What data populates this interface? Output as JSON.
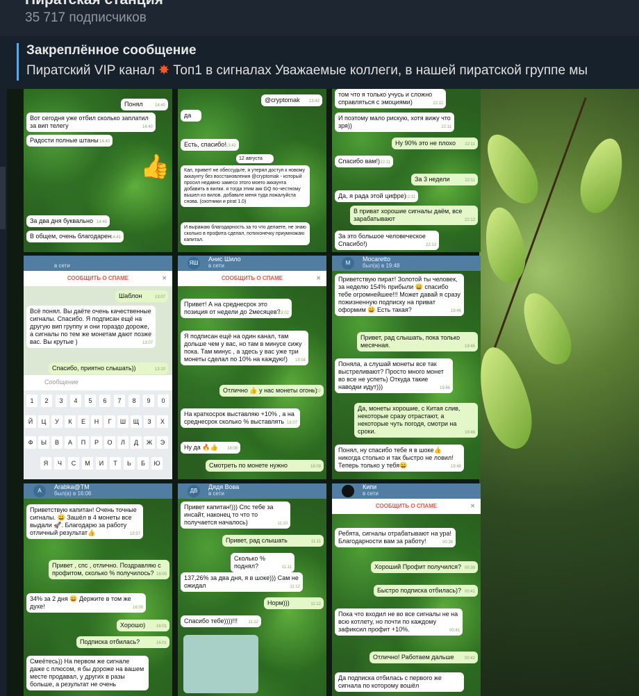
{
  "channel": {
    "title": "Пиратская станция",
    "subscribers": "35 717 подписчиков"
  },
  "pinned": {
    "label": "Закреплённое сообщение",
    "text_a": "Пиратский VIP канал",
    "text_b": "Топ1 в сигналах  Уважаемые коллеги, в нашей пиратской группе мы",
    "fire_icon": "fire-icon"
  },
  "tiles": {
    "t1": [
      {
        "text": "Понял",
        "time": "14:40"
      },
      {
        "text": "Вот сегодня уже отбил сколько заплатил за вип телегу",
        "time": "14:40"
      },
      {
        "text": "Радости полные штаны",
        "time": "14:40"
      },
      {
        "text": "За два дня буквально",
        "time": "14:40"
      },
      {
        "text": "В общем, очень благодарен",
        "time": "14:41"
      }
    ],
    "t2": [
      {
        "text": "@cryptomak",
        "time": "13:42"
      },
      {
        "text": "да",
        "time": "13:42"
      },
      {
        "text": "Есть, спасибо!",
        "time": "13:42"
      },
      {
        "text": "12 августа",
        "time": ""
      },
      {
        "text": "Кап, привет! не обессудьте, я утерял доступ к новому аккаунту без восстановления @cryptomak - который просил недавно замесо этого моего аккаунта добавить в вилки. я тогда этим акк GQ по-честному вышел из вилов. добавьте меня туда пожалуйста снова. (охотники и pirat 1.0)",
        "time": ""
      },
      {
        "text": "И выражаю благодарность за то что делаете, не знаю сколько в профита сделал, потихонечку приумножаю капитал.",
        "time": ""
      }
    ],
    "t3": [
      {
        "text": "том что я только учусь и сложно справляться с эмоциями)",
        "time": "22:11"
      },
      {
        "text": "И поэтому мало рискую, хотя вижу что зря))",
        "time": "22:11"
      },
      {
        "text": "Ну 90% это не плохо",
        "time": "22:11"
      },
      {
        "text": "Спасибо вам!)",
        "time": "22:11"
      },
      {
        "text": "За 3 недели",
        "time": "22:11"
      },
      {
        "text": "Да, я рада этой цифре)",
        "time": "22:11"
      },
      {
        "text": "В приват хорошие сигналы даём, все зарабатывают",
        "time": "22:12"
      },
      {
        "text": "За это большое человеческое Спасибо!)",
        "time": "22:13"
      }
    ],
    "t4": {
      "status": "в сети",
      "spam": "СООБЩИТЬ О СПАМЕ",
      "msgs": [
        {
          "text": "Шаблон",
          "time": "13:07"
        },
        {
          "text": "Всё понял. Вы даёте очень качественные сигналы. Спасибо. Я подписан ещё на другую вип группу и они гораздо дороже, а сигналы по тем же монетам дают позже вас. Вы крутые )",
          "time": "13:07"
        },
        {
          "text": "Спасибо, приятно слышать))",
          "time": "13:10"
        }
      ],
      "placeholder": "Сообщение",
      "row1": [
        "1",
        "2",
        "3",
        "4",
        "5",
        "6",
        "7",
        "8",
        "9",
        "0"
      ],
      "row2": [
        "Й",
        "Ц",
        "У",
        "К",
        "Е",
        "Н",
        "Г",
        "Ш",
        "Щ",
        "З",
        "Х"
      ],
      "row3": [
        "Ф",
        "Ы",
        "В",
        "А",
        "П",
        "Р",
        "О",
        "Л",
        "Д",
        "Ж",
        "Э"
      ],
      "row4": [
        "Я",
        "Ч",
        "С",
        "М",
        "И",
        "Т",
        "Ь",
        "Б",
        "Ю"
      ]
    },
    "t5": {
      "name": "Анис Шило",
      "status": "в сети",
      "spam": "СООБЩИТЬ О СПАМЕ",
      "msgs": [
        {
          "text": "Привет! А на среднесрок это позиция от недели до 2месяцев?",
          "time": "18:02"
        },
        {
          "text": "Я подписан ещё на один канал, там дольше чем у вас, но там в минусе сижу пока. Там минус , а здесь у вас уже три монеты сделал по 10% на каждую!)",
          "time": "18:04"
        },
        {
          "text": "Отлично 👍 у нас монеты огонь)",
          "time": "18:07"
        },
        {
          "text": "На краткосрок выставляю +10% , а на среднесрок сколько % выставлять",
          "time": "18:07"
        },
        {
          "text": "Ну да 🔥👍",
          "time": "18:08"
        },
        {
          "text": "Смотреть по монете нужно",
          "time": "18:09"
        }
      ]
    },
    "t6": {
      "name": "Mocaretto",
      "status": "был(а) в 19:48",
      "msgs": [
        {
          "text": "Приветствую пират! Золотой ты человек, за неделю 154% прибыли 😄 спасибо тебе огромнейшее!!! Может давай я сразу пожизненную подписку на приват оформим 😄 Есть такая?",
          "time": "19:46"
        },
        {
          "text": "Привет, рад слышать, пока только месячная.",
          "time": "19:46"
        },
        {
          "text": "Поняла, а слушай монеты все так выстреливают? Просто много монет во все не успеть) Откуда такие наводки идут)))",
          "time": "19:46"
        },
        {
          "text": "Да, монеты хорошие, с Китая слив, некоторые сразу отрастают, а некоторые чуть погодя, смотри на сроки.",
          "time": "19:46"
        },
        {
          "text": "Понял, ну спасибо тебе я в шоке👍 никогда столько и так быстро не ловил! Теперь только у тебя😄",
          "time": "19:48"
        }
      ]
    },
    "t7": {
      "name": "Arabka@TM",
      "status": "был(а) в 16:06",
      "msgs": [
        {
          "text": "Приветствую капитан! Очень точные сигналы. 😄 Зашёл в 4 монеты все выдали 🚀. Благодарю за работу отличный результат👍",
          "time": "15:57"
        },
        {
          "text": "Привет , спс , отлично. Поздравляю с профитом, сколько % получилось?",
          "time": "16:00"
        },
        {
          "text": "34% за 2 дня 😄 Держите в том же духе!",
          "time": "16:00"
        },
        {
          "text": "Хорошо)",
          "time": "16:01"
        },
        {
          "text": "Подписка отбилась?",
          "time": "16:01"
        },
        {
          "text": "Смеётесь)) На первом же сигнале даже с плюсом, я бы дороже на вашем месте продавал, у других в разы больше, а результат не очень",
          "time": ""
        }
      ]
    },
    "t8": {
      "name": "Дядя Вова",
      "status": "в сети",
      "msgs": [
        {
          "text": "Привет капитан!))) Спс тебе за инсайт, наконец то что то получается началось)",
          "time": "11:10"
        },
        {
          "text": "Привет, рад слышать",
          "time": "11:11"
        },
        {
          "text": "Сколько % поднял?",
          "time": "11:11"
        },
        {
          "text": "137,26% за два дня, я в шоке))) Сам не ожидал",
          "time": "11:12"
        },
        {
          "text": "Норм)))",
          "time": "11:12"
        },
        {
          "text": "Спасибо тебе))))!!!",
          "time": "11:12"
        }
      ]
    },
    "t9": {
      "name": "Кипи",
      "status": "в сети",
      "spam": "СООБЩИТЬ О СПАМЕ",
      "msgs": [
        {
          "text": "Ребята, сигналы отрабатывают на ура! Благодарности вам за работу!",
          "time": "00:38"
        },
        {
          "text": "Хороший Профит получился?",
          "time": "00:39"
        },
        {
          "text": "Быстро подписка отбилась)?",
          "time": "00:41"
        },
        {
          "text": "Пока что входил не во все сигналы не на всю котлету, но почти по каждому зафиксил профит +10%.",
          "time": "00:41"
        },
        {
          "text": "Отлично! Работаем дальше",
          "time": "00:42"
        },
        {
          "text": "Да подписка отбилась с первого же сигнала по которому вошёл",
          "time": ""
        }
      ]
    }
  }
}
